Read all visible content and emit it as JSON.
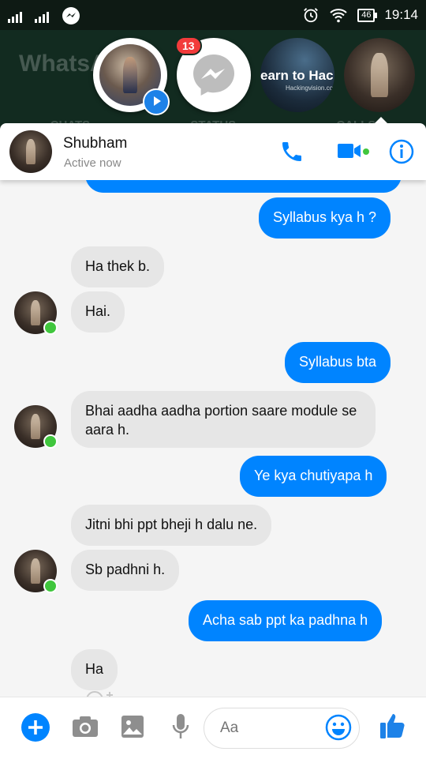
{
  "status_bar": {
    "time": "19:14",
    "battery": "46"
  },
  "background_app": {
    "title": "WhatsA",
    "tabs": [
      "CHATS",
      "STATUS",
      "CALLS"
    ]
  },
  "chat_heads": {
    "messenger_badge": "13",
    "story_text": "earn to Hac",
    "story_subtext": "Hackingvision.com"
  },
  "chat_header": {
    "contact_name": "Shubham",
    "status": "Active now"
  },
  "messages": [
    {
      "side": "out",
      "text": "Syllabus kya h ?"
    },
    {
      "side": "in",
      "text": "Ha thek b."
    },
    {
      "side": "in",
      "text": "Hai."
    },
    {
      "side": "out",
      "text": "Syllabus bta"
    },
    {
      "side": "in",
      "text": "Bhai aadha aadha portion saare module se aara h."
    },
    {
      "side": "out",
      "text": "Ye kya chutiyapa h"
    },
    {
      "side": "in",
      "text": "Jitni bhi ppt bheji h dalu ne."
    },
    {
      "side": "in",
      "text": "Sb padhni h."
    },
    {
      "side": "out",
      "text": "Acha sab ppt ka padhna h"
    },
    {
      "side": "in",
      "text": "Ha"
    }
  ],
  "composer": {
    "placeholder": "Aa"
  },
  "colors": {
    "accent": "#0084ff",
    "incoming_bubble": "#e6e6e6",
    "online": "#40c63d",
    "like": "#1d82e8"
  }
}
